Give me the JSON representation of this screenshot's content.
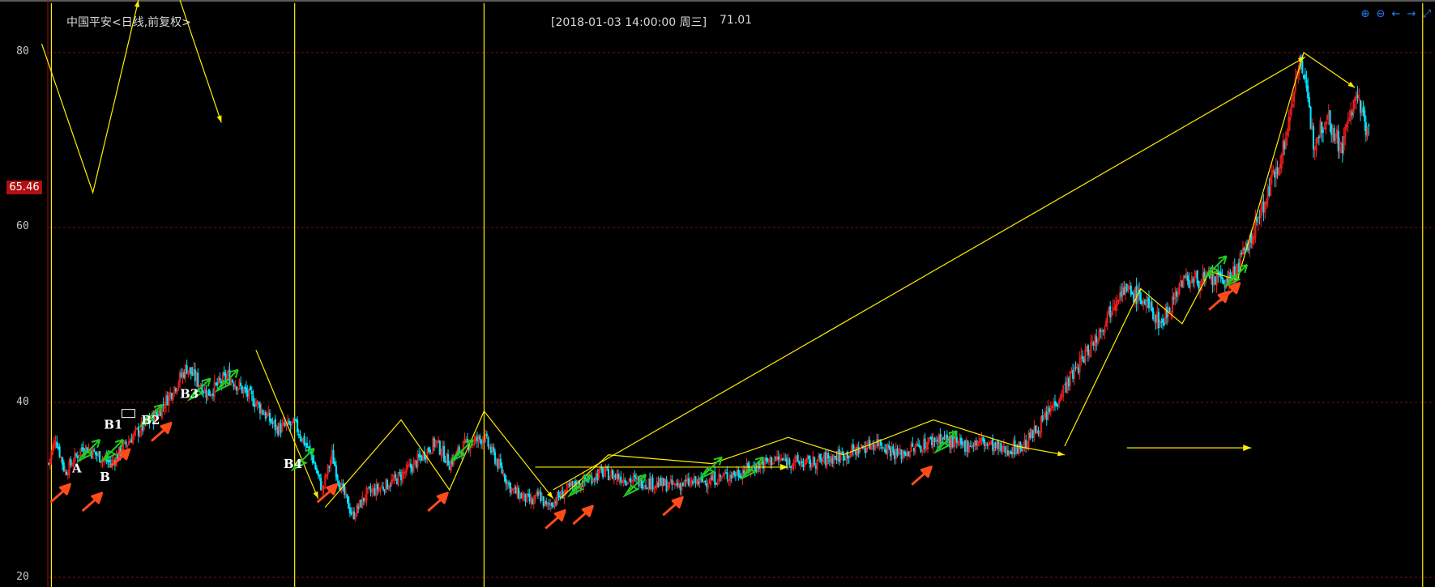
{
  "header": {
    "title": "中国平安<日线,前复权>",
    "cursor_info": "[2018-01-03  14:00:00 周三]",
    "cursor_price": "71.01"
  },
  "price_badge": "65.46",
  "toolbar": [
    {
      "name": "zoom-in-icon",
      "glyph": "⊕"
    },
    {
      "name": "zoom-out-icon",
      "glyph": "⊖"
    },
    {
      "name": "scroll-left-icon",
      "glyph": "←"
    },
    {
      "name": "scroll-right-icon",
      "glyph": "→"
    },
    {
      "name": "restore-icon",
      "glyph": "⤢"
    }
  ],
  "colors": {
    "up": "#ff2020",
    "down": "#00e5ff",
    "zigzag": "#ffee00",
    "buy_arrow": "#ff4a1a",
    "sell_arrow": "#22cc22",
    "grid": "#7a0f0f"
  },
  "chart_data": {
    "type": "candlestick",
    "ylim": [
      20,
      82
    ],
    "yticks": [
      20,
      40,
      60,
      80
    ],
    "grid": true,
    "x_count": 1000,
    "vlines": [
      2,
      178,
      315,
      994
    ],
    "anchors": [
      [
        0,
        33
      ],
      [
        5,
        36
      ],
      [
        12,
        32
      ],
      [
        25,
        35
      ],
      [
        45,
        33
      ],
      [
        60,
        36
      ],
      [
        80,
        39
      ],
      [
        100,
        44
      ],
      [
        115,
        41
      ],
      [
        130,
        43
      ],
      [
        150,
        40
      ],
      [
        165,
        37
      ],
      [
        178,
        37.5
      ],
      [
        190,
        34
      ],
      [
        198,
        30
      ],
      [
        205,
        34
      ],
      [
        210,
        31
      ],
      [
        215,
        29
      ],
      [
        220,
        27
      ],
      [
        230,
        29.5
      ],
      [
        250,
        31
      ],
      [
        265,
        33
      ],
      [
        280,
        35.5
      ],
      [
        290,
        33
      ],
      [
        300,
        35
      ],
      [
        315,
        36
      ],
      [
        325,
        33
      ],
      [
        335,
        30
      ],
      [
        350,
        28.5
      ],
      [
        355,
        29.5
      ],
      [
        360,
        28
      ],
      [
        375,
        30
      ],
      [
        400,
        32
      ],
      [
        425,
        31
      ],
      [
        450,
        30.5
      ],
      [
        475,
        31
      ],
      [
        500,
        32
      ],
      [
        525,
        33.5
      ],
      [
        550,
        33
      ],
      [
        575,
        34
      ],
      [
        600,
        35.5
      ],
      [
        615,
        34
      ],
      [
        630,
        35
      ],
      [
        645,
        36
      ],
      [
        660,
        35
      ],
      [
        675,
        35.5
      ],
      [
        690,
        34.5
      ],
      [
        705,
        35
      ],
      [
        720,
        38
      ],
      [
        740,
        43
      ],
      [
        760,
        48
      ],
      [
        775,
        53
      ],
      [
        790,
        52
      ],
      [
        805,
        49
      ],
      [
        820,
        54
      ],
      [
        840,
        54
      ],
      [
        855,
        54
      ],
      [
        868,
        58
      ],
      [
        882,
        64
      ],
      [
        895,
        70
      ],
      [
        905,
        80
      ],
      [
        915,
        70
      ],
      [
        925,
        73
      ],
      [
        935,
        69
      ],
      [
        945,
        75
      ],
      [
        955,
        71
      ]
    ],
    "zigzag": [
      [
        [
          -5,
          81
        ],
        [
          32,
          64
        ],
        [
          65,
          86
        ]
      ],
      [
        [
          95,
          86
        ],
        [
          125,
          72
        ]
      ],
      [
        [
          150,
          46
        ],
        [
          195,
          29
        ]
      ],
      [
        [
          200,
          28
        ],
        [
          255,
          38
        ],
        [
          290,
          30
        ],
        [
          315,
          39
        ],
        [
          365,
          29
        ]
      ],
      [
        [
          370,
          29
        ],
        [
          405,
          34
        ],
        [
          480,
          33
        ],
        [
          535,
          36
        ],
        [
          575,
          34
        ],
        [
          640,
          38
        ],
        [
          700,
          35
        ],
        [
          735,
          34
        ]
      ],
      [
        [
          365,
          30
        ],
        [
          909,
          79.5
        ]
      ],
      [
        [
          735,
          35
        ],
        [
          790,
          53
        ],
        [
          820,
          49
        ],
        [
          840,
          55
        ],
        [
          860,
          54
        ],
        [
          908,
          80
        ],
        [
          945,
          76
        ]
      ]
    ],
    "hlines": [
      [
        352,
        535,
        32.6
      ],
      [
        780,
        870,
        34.8
      ]
    ],
    "labels": [
      {
        "text": "A",
        "x": 17,
        "y": 32
      },
      {
        "text": "B",
        "x": 37,
        "y": 31
      },
      {
        "text": "B1",
        "x": 40,
        "y": 37
      },
      {
        "text": "B2",
        "x": 67,
        "y": 37.5
      },
      {
        "text": "B3",
        "x": 95,
        "y": 40.5
      },
      {
        "text": "B4",
        "x": 170,
        "y": 32.5
      }
    ],
    "buy_signals": [
      [
        12,
        31
      ],
      [
        35,
        30
      ],
      [
        55,
        35
      ],
      [
        85,
        38
      ],
      [
        205,
        31
      ],
      [
        285,
        30
      ],
      [
        370,
        28
      ],
      [
        390,
        28.5
      ],
      [
        455,
        29.5
      ],
      [
        635,
        33
      ],
      [
        850,
        53
      ],
      [
        858,
        54
      ]
    ],
    "sell_signals": [
      [
        30,
        35
      ],
      [
        47,
        35
      ],
      [
        75,
        39
      ],
      [
        110,
        42
      ],
      [
        130,
        43
      ],
      [
        185,
        34
      ],
      [
        300,
        35
      ],
      [
        385,
        31
      ],
      [
        425,
        31
      ],
      [
        480,
        33
      ],
      [
        510,
        33
      ],
      [
        650,
        36
      ],
      [
        845,
        56
      ],
      [
        860,
        55
      ]
    ]
  }
}
